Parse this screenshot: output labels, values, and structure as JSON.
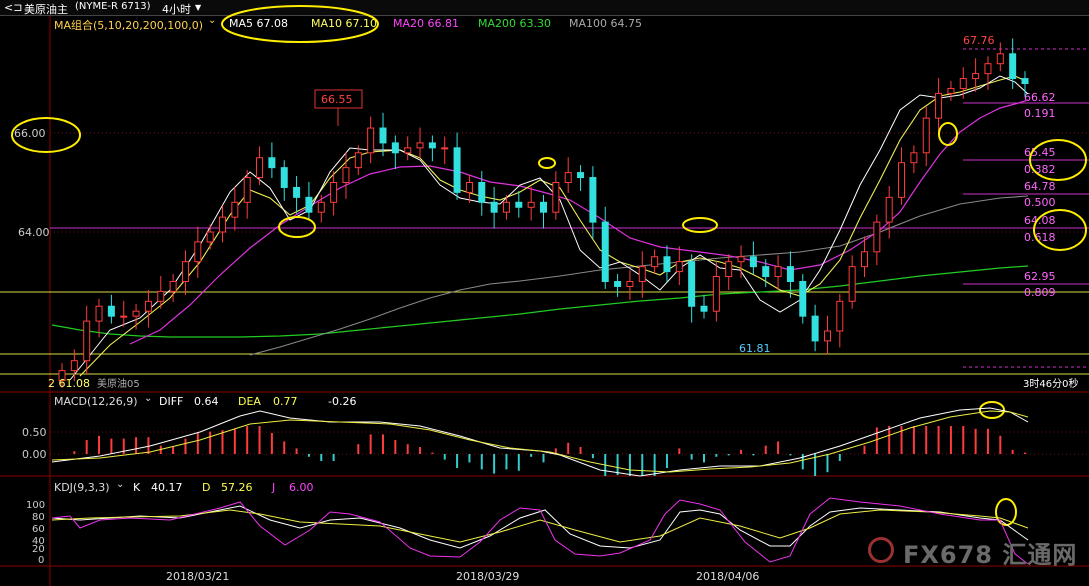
{
  "header": {
    "back_label": "<⊐",
    "symbol": "美原油主",
    "code": "(NYME-R 6713)",
    "period": "4小时",
    "period_icon": "chevron-down-icon"
  },
  "price_indicators": {
    "group_label": "MA组合(5,10,20,200,100,0)",
    "items": [
      {
        "label": "MA5 67.08",
        "color": "#ffffff"
      },
      {
        "label": "MA10 67.10",
        "color": "#ffff66"
      },
      {
        "label": "MA20 66.81",
        "color": "#ff44ff"
      },
      {
        "label": "MA200 63.30",
        "color": "#33dd33"
      },
      {
        "label": "MA100 64.75",
        "color": "#aaaaaa"
      }
    ]
  },
  "price_axis": {
    "labels": [
      "66.00",
      "64.00"
    ]
  },
  "price_annotations": {
    "high_label": "67.76",
    "box_label": "66.55",
    "low_label": "61.81",
    "bottom_left": "2 61.08",
    "bottom_tag": "美原油05",
    "countdown": "3时46分0秒"
  },
  "fib_levels": [
    {
      "price": "66.62",
      "ratio": "0.191"
    },
    {
      "price": "65.45",
      "ratio": "0.382"
    },
    {
      "price": "64.78",
      "ratio": "0.500"
    },
    {
      "price": "64.08",
      "ratio": "0.618"
    },
    {
      "price": "62.95",
      "ratio": "0.809"
    }
  ],
  "macd": {
    "label": "MACD(12,26,9)",
    "diff_label": "DIFF",
    "diff_value": "0.64",
    "dea_label": "DEA",
    "dea_value": "0.77",
    "macd_value": "-0.26",
    "axis_labels": [
      "0.50",
      "0.00"
    ]
  },
  "kdj": {
    "label": "KDJ(9,3,3)",
    "k_label": "K",
    "k_value": "40.17",
    "d_label": "D",
    "d_value": "57.26",
    "j_label": "J",
    "j_value": "6.00",
    "axis_labels": [
      "100",
      "80",
      "60",
      "40",
      "20",
      "0"
    ]
  },
  "dates": [
    "2018/03/21",
    "2018/03/29",
    "2018/04/06"
  ],
  "watermark": "FX678 汇通网",
  "chart_data": {
    "type": "candlestick",
    "title": "美原油主 (NYME-R 6713) 4小时",
    "y_axis_ticks": [
      66.0,
      64.0
    ],
    "x_tick_labels": [
      "2018/03/21",
      "2018/03/29",
      "2018/04/06"
    ],
    "annotated_points": {
      "high": 67.76,
      "marked": 66.55,
      "low": 61.81,
      "start": 61.08
    },
    "fibonacci": [
      {
        "ratio": 0.191,
        "price": 66.62
      },
      {
        "ratio": 0.382,
        "price": 65.45
      },
      {
        "ratio": 0.5,
        "price": 64.78
      },
      {
        "ratio": 0.618,
        "price": 64.08
      },
      {
        "ratio": 0.809,
        "price": 62.95
      }
    ],
    "moving_averages": {
      "MA5": 67.08,
      "MA10": 67.1,
      "MA20": 66.81,
      "MA200": 63.3,
      "MA100": 64.75
    },
    "macd": {
      "DIFF": 0.64,
      "DEA": 0.77,
      "MACD": -0.26
    },
    "kdj": {
      "K": 40.17,
      "D": 57.26,
      "J": 6.0
    },
    "candles_close_approx": [
      61.2,
      61.4,
      62.2,
      62.5,
      62.3,
      62.3,
      62.4,
      62.6,
      62.8,
      63.0,
      63.4,
      63.8,
      64.0,
      64.3,
      64.6,
      65.1,
      65.5,
      65.3,
      64.9,
      64.7,
      64.4,
      64.6,
      65.0,
      65.3,
      65.6,
      66.1,
      65.8,
      65.6,
      65.7,
      65.8,
      65.7,
      65.7,
      64.8,
      65.0,
      64.6,
      64.4,
      64.6,
      64.5,
      64.6,
      64.4,
      65.0,
      65.2,
      65.1,
      64.2,
      63.0,
      62.9,
      63.0,
      63.3,
      63.5,
      63.2,
      63.4,
      62.5,
      62.4,
      63.1,
      63.4,
      63.5,
      63.3,
      63.1,
      63.3,
      63.0,
      62.3,
      61.8,
      62.0,
      62.6,
      63.3,
      63.6,
      64.2,
      64.7,
      65.4,
      65.6,
      66.3,
      66.8,
      66.9,
      67.1,
      67.2,
      67.4,
      67.6,
      67.1,
      67.0
    ]
  }
}
